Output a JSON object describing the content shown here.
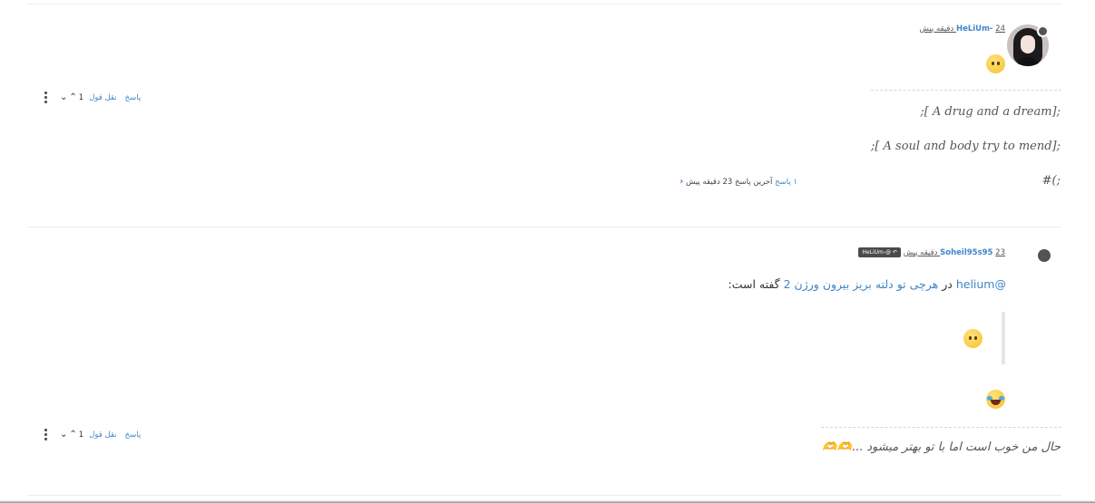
{
  "posts": [
    {
      "username": "HeLiUm-",
      "time": "24 دقیقه پیش",
      "lines": [
        ";[ A drug and a dream];",
        ";[ A soul and body try to mend];",
        "#(;"
      ],
      "replies_summary": {
        "count": "۱ پاسخ",
        "last": "آخرین پاسخ 23 دقیقه پیش"
      },
      "actions": {
        "reply": "پاسخ",
        "quote": "نقل قول",
        "votes": "1"
      },
      "emoji": "neutral-face"
    },
    {
      "username": "Soheil95s95",
      "time": "23 دقیقه پیش",
      "parent_badge": "HeLiUm-@",
      "mention": {
        "user": "@helium",
        "before_link": "در",
        "link": "هرچی تو دلته بریز بیرون ورژن 2",
        "after": "گفته است:"
      },
      "quote_emoji": "neutral-face",
      "emoji": "rolling-laughing",
      "text": "حال من خوب است اما با تو بهتر میشود ...🫶🫶",
      "actions": {
        "reply": "پاسخ",
        "quote": "نقل قول",
        "votes": "1"
      }
    }
  ],
  "colors": {
    "link": "#3f86c8",
    "status": "#505357"
  }
}
